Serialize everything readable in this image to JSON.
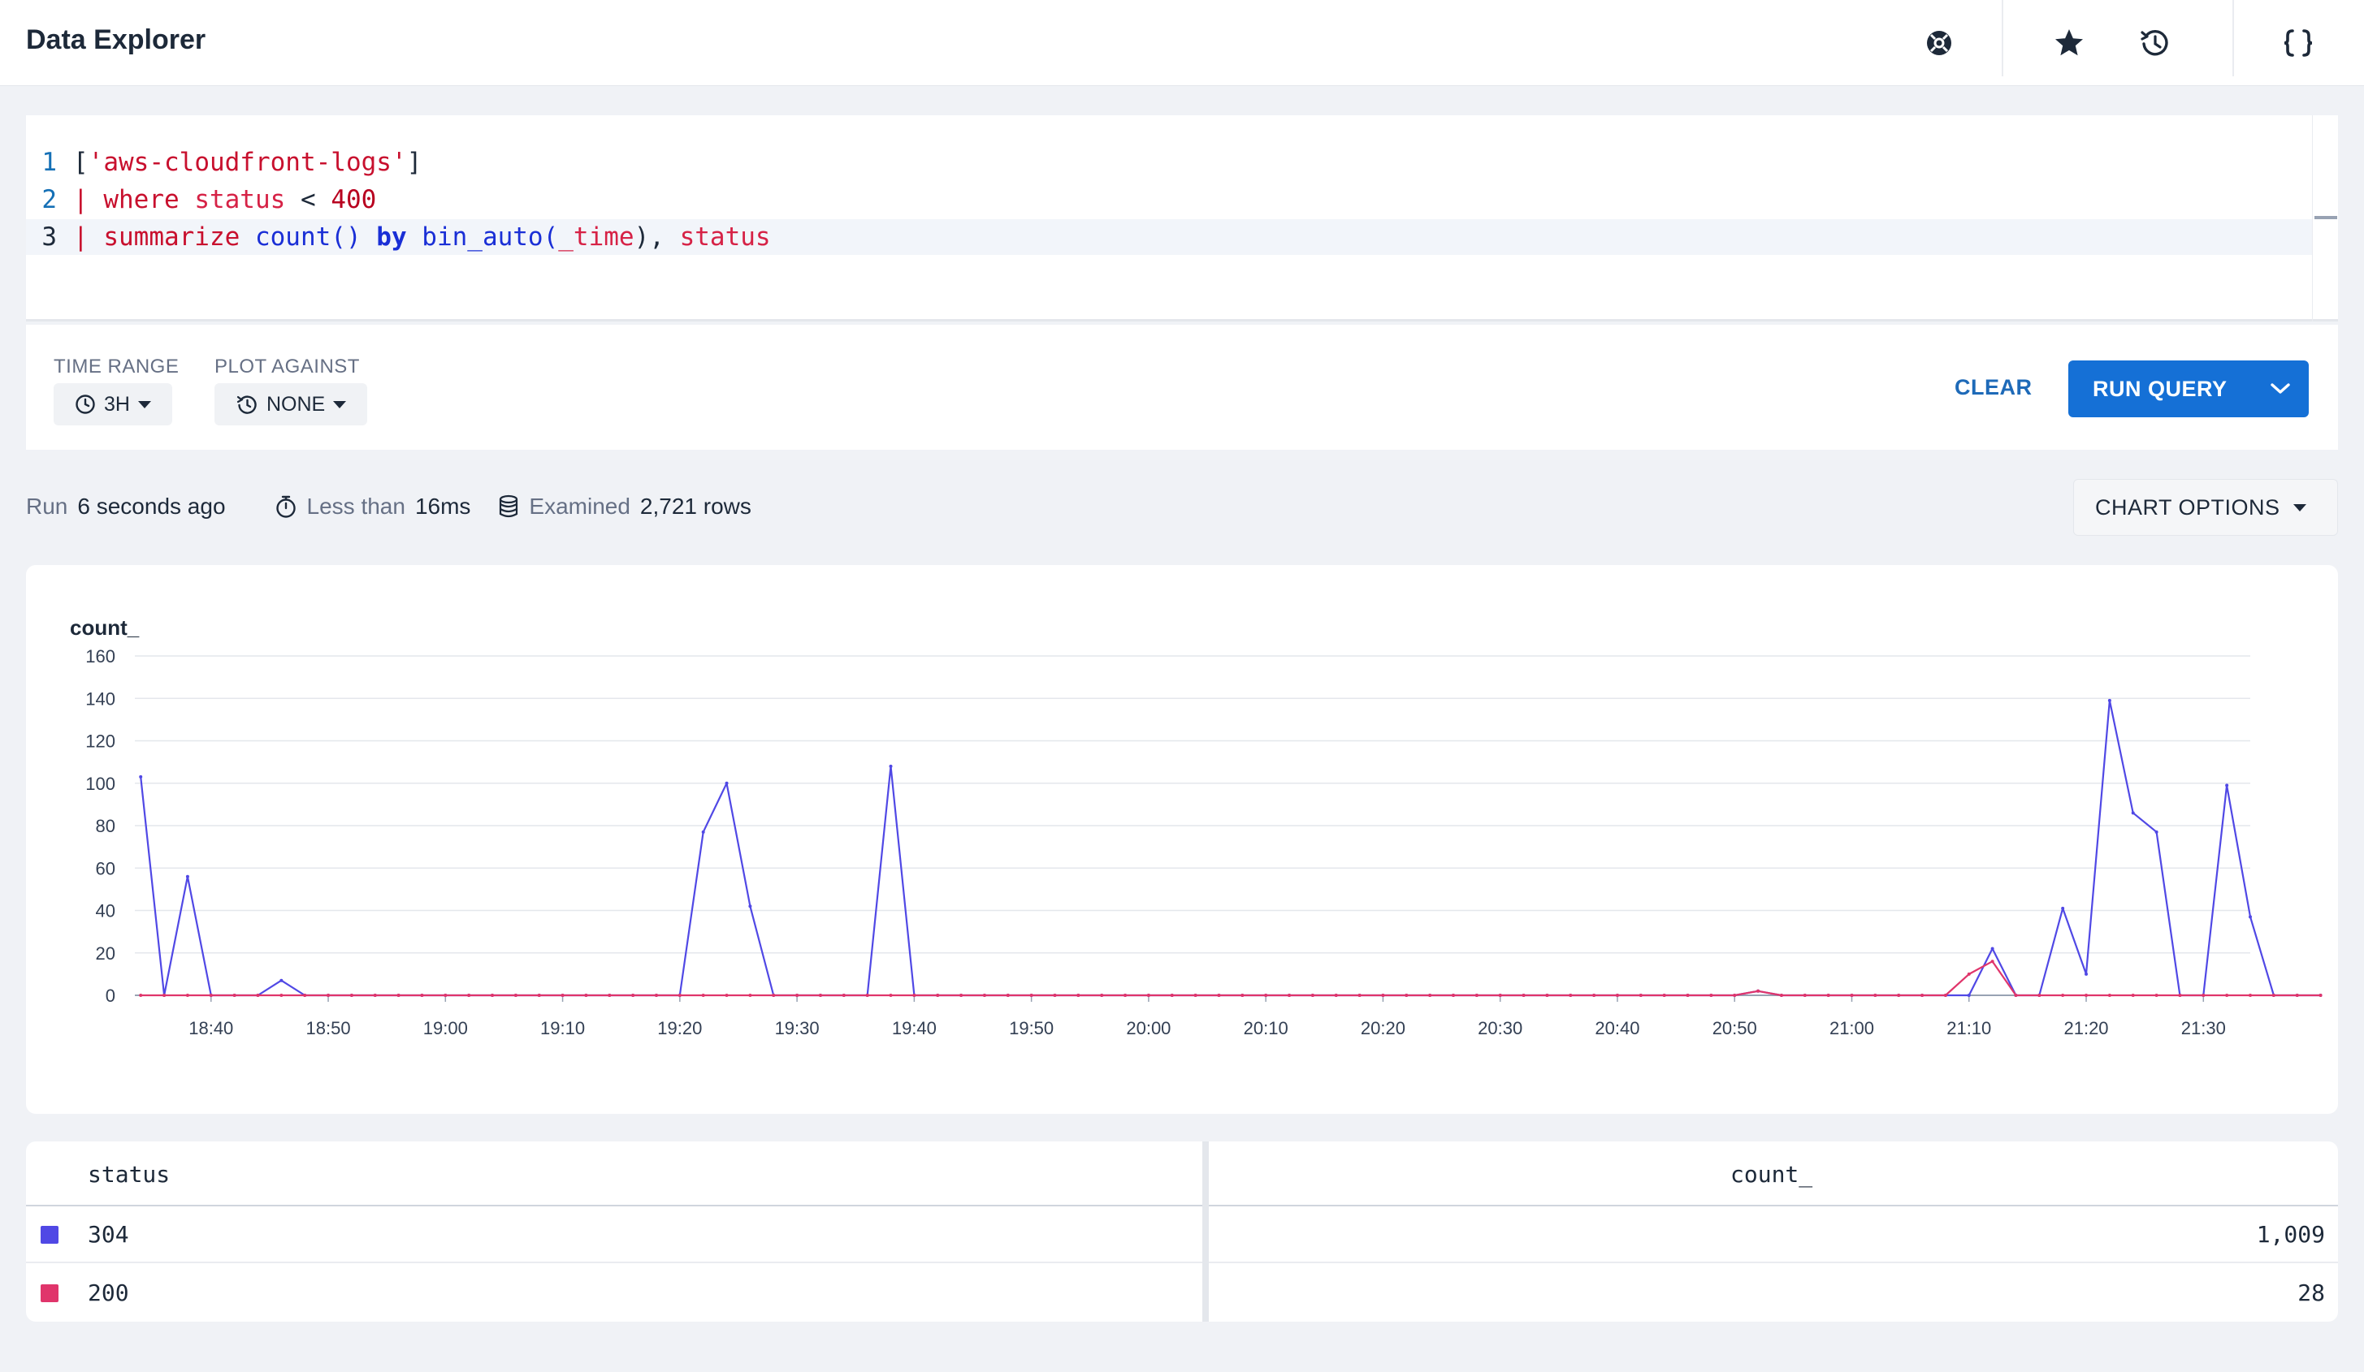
{
  "header": {
    "title": "Data Explorer",
    "icons": [
      "lifebuoy-icon",
      "star-icon",
      "history-icon",
      "braces-icon"
    ]
  },
  "editor": {
    "line_numbers": [
      "1",
      "2",
      "3"
    ],
    "line1": {
      "open": "[",
      "str": "'aws-cloudfront-logs'",
      "close": "]"
    },
    "line2": {
      "pipe": "| ",
      "kw": "where",
      "field": " status",
      "op": " < ",
      "num": "400"
    },
    "line3": {
      "pipe": "| ",
      "kw": "summarize",
      "fn": " count()",
      "by": " by",
      "fn2": " bin_auto(",
      "arg": "_time",
      "rest": "), ",
      "field": "status"
    }
  },
  "controls": {
    "time_range_label": "TIME RANGE",
    "time_range_value": "3H",
    "plot_against_label": "PLOT AGAINST",
    "plot_against_value": "NONE",
    "clear_label": "CLEAR",
    "run_label": "RUN QUERY"
  },
  "status": {
    "run_prefix": "Run",
    "run_value": "6 seconds ago",
    "duration_prefix": "Less than",
    "duration_value": "16ms",
    "examined_prefix": "Examined",
    "examined_value": "2,721 rows",
    "chart_options_label": "CHART OPTIONS"
  },
  "colors": {
    "series_304": "#5048e5",
    "series_200": "#e0356b",
    "accent": "#1570d6"
  },
  "chart_data": {
    "type": "line",
    "ylabel": "count_",
    "ylim": [
      0,
      160
    ],
    "yticks": [
      0,
      20,
      40,
      60,
      80,
      100,
      120,
      140,
      160
    ],
    "xticks": [
      "18:40",
      "18:50",
      "19:00",
      "19:10",
      "19:20",
      "19:30",
      "19:40",
      "19:50",
      "20:00",
      "20:10",
      "20:20",
      "20:30",
      "20:40",
      "20:50",
      "21:00",
      "21:10",
      "21:20",
      "21:30"
    ],
    "xrange_minutes": [
      -6.5,
      174
    ],
    "grid": true,
    "series": [
      {
        "name": "304",
        "color": "#5048e5",
        "points": [
          [
            -6,
            103
          ],
          [
            -4,
            0
          ],
          [
            -2,
            56
          ],
          [
            0,
            0
          ],
          [
            2,
            0
          ],
          [
            4,
            0
          ],
          [
            6,
            7
          ],
          [
            8,
            0
          ],
          [
            10,
            0
          ],
          [
            38,
            0
          ],
          [
            40,
            0
          ],
          [
            42,
            77
          ],
          [
            44,
            100
          ],
          [
            46,
            42
          ],
          [
            48,
            0
          ],
          [
            50,
            0
          ],
          [
            52,
            0
          ],
          [
            54,
            0
          ],
          [
            56,
            0
          ],
          [
            58,
            108
          ],
          [
            60,
            0
          ],
          [
            62,
            0
          ],
          [
            128,
            0
          ],
          [
            130,
            0
          ],
          [
            132,
            2
          ],
          [
            134,
            0
          ],
          [
            136,
            0
          ],
          [
            146,
            0
          ],
          [
            148,
            0
          ],
          [
            150,
            0
          ],
          [
            152,
            22
          ],
          [
            154,
            0
          ],
          [
            156,
            0
          ],
          [
            158,
            41
          ],
          [
            160,
            10
          ],
          [
            162,
            139
          ],
          [
            164,
            86
          ],
          [
            166,
            77
          ],
          [
            168,
            0
          ],
          [
            170,
            0
          ],
          [
            172,
            99
          ],
          [
            174,
            37
          ],
          [
            176,
            0
          ],
          [
            178,
            0
          ],
          [
            180,
            0
          ]
        ]
      },
      {
        "name": "200",
        "color": "#e0356b",
        "points": [
          [
            -6,
            0
          ],
          [
            -4,
            0
          ],
          [
            42,
            0
          ],
          [
            44,
            0
          ],
          [
            46,
            0
          ],
          [
            130,
            0
          ],
          [
            132,
            2
          ],
          [
            134,
            0
          ],
          [
            148,
            0
          ],
          [
            150,
            10
          ],
          [
            152,
            16
          ],
          [
            154,
            0
          ],
          [
            166,
            0
          ],
          [
            168,
            0
          ]
        ]
      }
    ]
  },
  "table": {
    "headers": [
      "status",
      "count_"
    ],
    "rows": [
      {
        "status": "304",
        "count": "1,009",
        "color": "#5048e5"
      },
      {
        "status": "200",
        "count": "28",
        "color": "#e0356b"
      }
    ]
  }
}
